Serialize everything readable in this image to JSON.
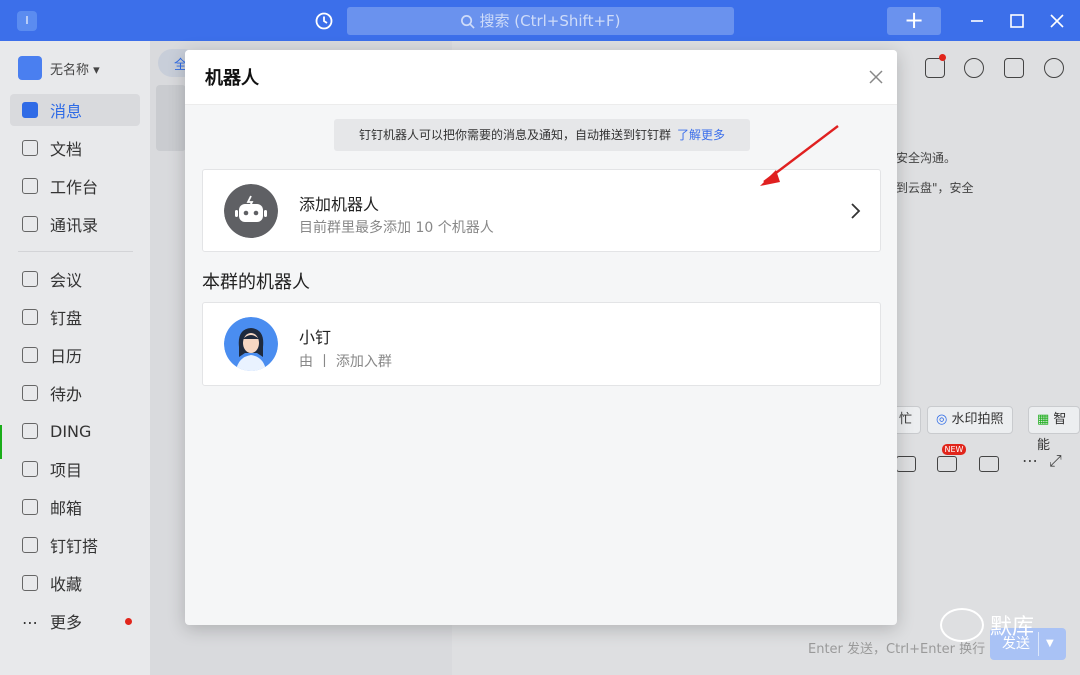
{
  "titlebar": {
    "app_badge": "I",
    "search_placeholder": "搜索 (Ctrl+Shift+F)",
    "plus": "+"
  },
  "sidebar": {
    "org_name": "无名称 ▾",
    "items": [
      {
        "label": "消息",
        "icon": "message-icon"
      },
      {
        "label": "文档",
        "icon": "doc-icon"
      },
      {
        "label": "工作台",
        "icon": "grid-icon"
      },
      {
        "label": "通讯录",
        "icon": "contacts-icon"
      },
      {
        "label": "会议",
        "icon": "meeting-icon"
      },
      {
        "label": "钉盘",
        "icon": "cloud-icon"
      },
      {
        "label": "日历",
        "icon": "calendar-icon"
      },
      {
        "label": "待办",
        "icon": "todo-icon"
      },
      {
        "label": "DING",
        "icon": "ding-icon"
      },
      {
        "label": "项目",
        "icon": "project-icon"
      },
      {
        "label": "邮箱",
        "icon": "mail-icon"
      },
      {
        "label": "钉钉搭",
        "icon": "builder-icon"
      },
      {
        "label": "收藏",
        "icon": "folder-icon"
      },
      {
        "label": "更多",
        "icon": "more-icon"
      }
    ]
  },
  "midcol": {
    "chip": "全"
  },
  "right": {
    "line1": "安全沟通。",
    "line2": "到云盘\"，安全",
    "pill_partial": "忙",
    "pill_watermark": "水印拍照",
    "pill_smart": "智能",
    "new_badge": "NEW",
    "hint": "Enter 发送，Ctrl+Enter 换行",
    "send": "发送",
    "watermark": "默库"
  },
  "modal": {
    "title": "机器人",
    "notice": "钉钉机器人可以把你需要的消息及通知，自动推送到钉钉群",
    "notice_link": "了解更多",
    "add_title": "添加机器人",
    "add_sub": "目前群里最多添加 10 个机器人",
    "section": "本群的机器人",
    "bot_name": "小钉",
    "bot_sub": "由 丨 添加入群"
  },
  "colors": {
    "titlebar": "#3c6fea",
    "accent": "#2f6be6",
    "dot": "#e1251b",
    "annotation": "#e02020"
  }
}
